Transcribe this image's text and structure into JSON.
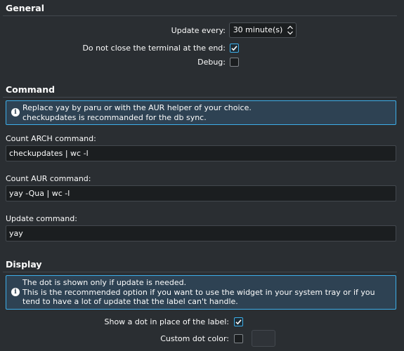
{
  "general": {
    "title": "General",
    "update_every_label": "Update every:",
    "update_every_value": "30 minute(s)",
    "do_not_close_label": "Do not close the terminal at the end:",
    "do_not_close_checked": true,
    "debug_label": "Debug:",
    "debug_checked": false
  },
  "command": {
    "title": "Command",
    "info_text": "Replace yay by paru or with the AUR helper of your choice.\n checkupdates is recommanded for the db sync.",
    "count_arch_label": "Count ARCH command:",
    "count_arch_value": "checkupdates | wc -l",
    "count_aur_label": "Count AUR command:",
    "count_aur_value": "yay -Qua | wc -l",
    "update_label": "Update command:",
    "update_value": "yay"
  },
  "display": {
    "title": "Display",
    "info_text": "The dot is shown only if update is needed.\nThis is the recommended option if you want to use the widget in your system tray or if you tend to have a lot of update that the label can't handle.",
    "show_dot_label": "Show a dot in place of the label:",
    "show_dot_checked": true,
    "custom_dot_color_label": "Custom dot color:",
    "custom_dot_color_checked": false
  },
  "colors": {
    "background": "#2a2e32",
    "accent": "#3daee9",
    "info_background": "#2e4253",
    "field_background": "#1b1e20"
  },
  "icons": {
    "info": "info-icon",
    "spin_arrows": "chevron-up-down-icon",
    "checkmark": "checkmark-icon"
  }
}
